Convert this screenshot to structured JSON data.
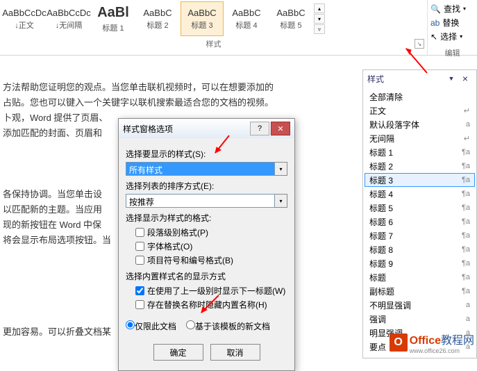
{
  "ribbon": {
    "styles": [
      {
        "preview": "AaBbCcDc",
        "label": "↓正文"
      },
      {
        "preview": "AaBbCcDc",
        "label": "↓无间隔"
      },
      {
        "preview": "AaBl",
        "label": "标题 1",
        "big": true
      },
      {
        "preview": "AaBbC",
        "label": "标题 2"
      },
      {
        "preview": "AaBbC",
        "label": "标题 3",
        "selected": true
      },
      {
        "preview": "AaBbC",
        "label": "标题 4"
      },
      {
        "preview": "AaBbC",
        "label": "标题 5"
      }
    ],
    "group_label": "样式",
    "edit": {
      "find": "查找",
      "replace": "替换",
      "select": "选择",
      "label": "编辑"
    }
  },
  "doc_lines": [
    "方法帮助您证明您的观点。当您单击联机视频时，可以在想要添加的",
    "占贴。您也可以键入一个关键字以联机搜索最适合您的文档的视频。",
    "卜观，Word 提供了页眉、",
    "添加匹配的封面、页眉和",
    "",
    "",
    "",
    "各保持协调。当您单击设",
    "以匹配新的主题。当应用",
    "现的新按钮在 Word 中保",
    "将会显示布局选项按钮。当",
    "",
    "",
    "",
    "",
    "",
    "更加容易。可以折叠文档某"
  ],
  "dialog": {
    "title": "样式窗格选项",
    "show_label": "选择要显示的样式(S):",
    "show_value": "所有样式",
    "sort_label": "选择列表的排序方式(E):",
    "sort_value": "按推荐",
    "fmt_label": "选择显示为样式的格式:",
    "chk1": "段落级别格式(P)",
    "chk2": "字体格式(O)",
    "chk3": "项目符号和编号格式(B)",
    "builtin_label": "选择内置样式名的显示方式",
    "chk4": "在使用了上一级别时显示下一标题(W)",
    "chk5": "存在替换名称时隐藏内置名称(H)",
    "radio1": "仅限此文档",
    "radio2": "基于该模板的新文档",
    "ok": "确定",
    "cancel": "取消"
  },
  "pane": {
    "title": "样式",
    "items": [
      {
        "name": "全部清除",
        "sym": ""
      },
      {
        "name": "正文",
        "sym": "↵"
      },
      {
        "name": "默认段落字体",
        "sym": "a"
      },
      {
        "name": "无间隔",
        "sym": "↵"
      },
      {
        "name": "标题 1",
        "sym": "¶a"
      },
      {
        "name": "标题 2",
        "sym": "¶a"
      },
      {
        "name": "标题 3",
        "sym": "¶a",
        "active": true
      },
      {
        "name": "标题 4",
        "sym": "¶a"
      },
      {
        "name": "标题 5",
        "sym": "¶a"
      },
      {
        "name": "标题 6",
        "sym": "¶a"
      },
      {
        "name": "标题 7",
        "sym": "¶a"
      },
      {
        "name": "标题 8",
        "sym": "¶a"
      },
      {
        "name": "标题 9",
        "sym": "¶a"
      },
      {
        "name": "标题",
        "sym": "¶a"
      },
      {
        "name": "副标题",
        "sym": "¶a"
      },
      {
        "name": "不明显强调",
        "sym": "a"
      },
      {
        "name": "强调",
        "sym": "a"
      },
      {
        "name": "明显强调",
        "sym": "a"
      },
      {
        "name": "要点",
        "sym": "a"
      }
    ]
  },
  "watermark": {
    "brand": "Office",
    "suffix": "教程网",
    "url": "www.office26.com"
  }
}
